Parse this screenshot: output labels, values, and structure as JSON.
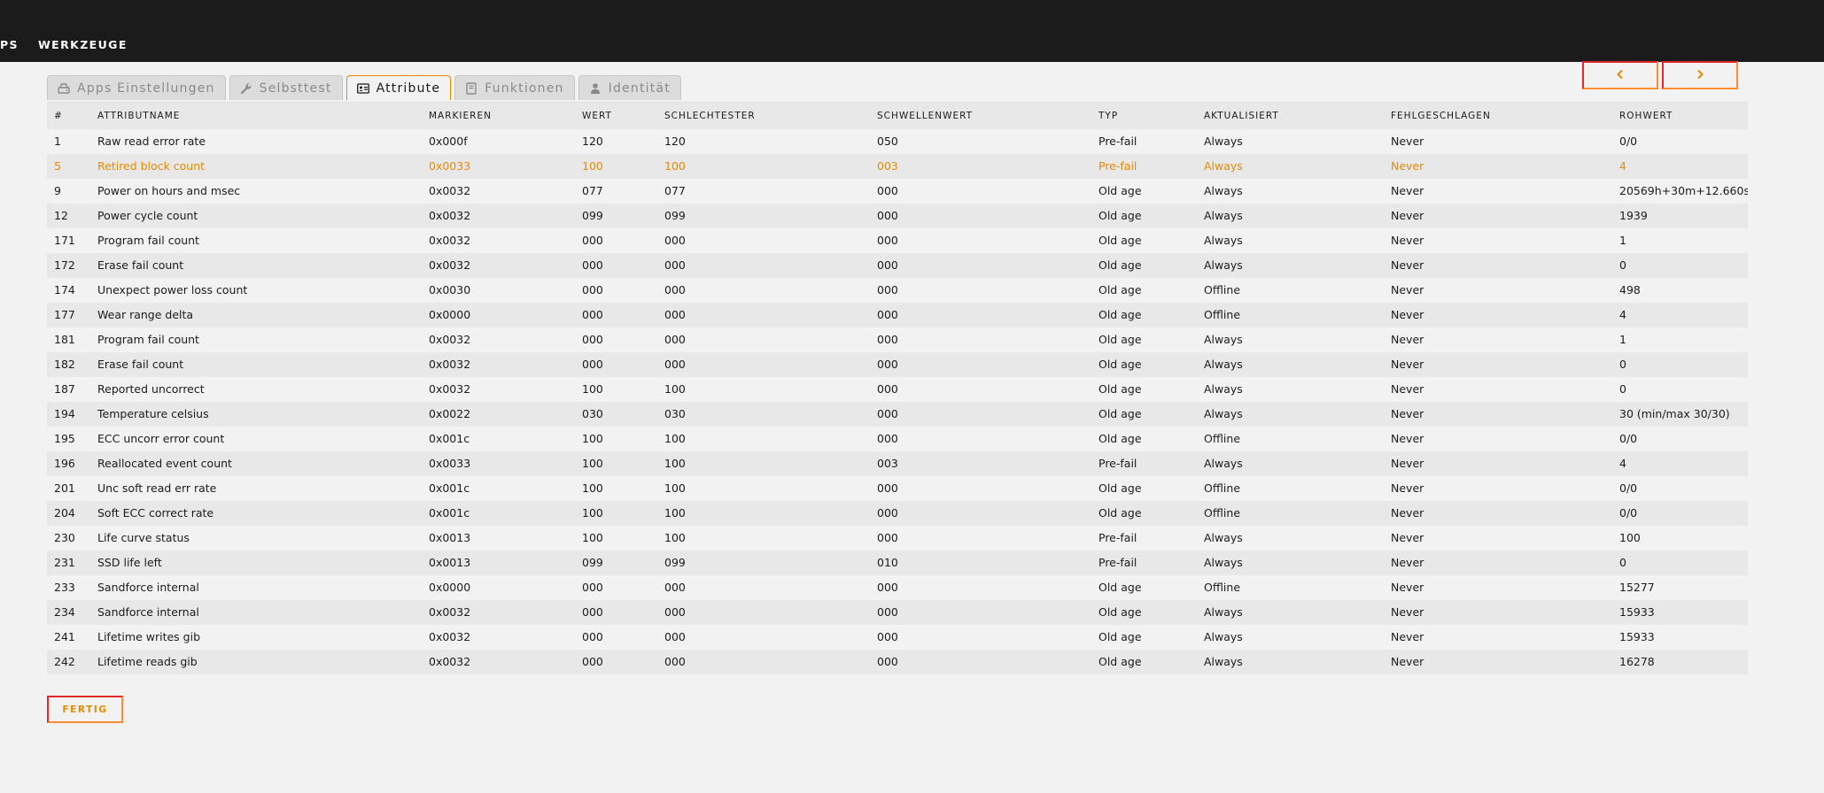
{
  "topnav": {
    "items": [
      "PS",
      "WERKZEUGE"
    ]
  },
  "tabs": [
    {
      "label": "Apps Einstellungen",
      "icon": "hdd-icon",
      "active": false
    },
    {
      "label": "Selbsttest",
      "icon": "wrench-icon",
      "active": false
    },
    {
      "label": "Attribute",
      "icon": "id-card-icon",
      "active": true
    },
    {
      "label": "Funktionen",
      "icon": "book-icon",
      "active": false
    },
    {
      "label": "Identität",
      "icon": "user-icon",
      "active": false
    }
  ],
  "navigation": {
    "prev_icon": "chevron-left-icon",
    "next_icon": "chevron-right-icon"
  },
  "colors": {
    "accent": "#e68a00",
    "border_red": "#e22828",
    "topbar": "#1c1b1b"
  },
  "table": {
    "headers": [
      "#",
      "ATTRIBUTNAME",
      "MARKIEREN",
      "WERT",
      "SCHLECHTESTER",
      "SCHWELLENWERT",
      "TYP",
      "AKTUALISIERT",
      "FEHLGESCHLAGEN",
      "ROHWERT"
    ],
    "rows": [
      [
        "1",
        "Raw read error rate",
        "0x000f",
        "120",
        "120",
        "050",
        "Pre-fail",
        "Always",
        "Never",
        "0/0"
      ],
      [
        "5",
        "Retired block count",
        "0x0033",
        "100",
        "100",
        "003",
        "Pre-fail",
        "Always",
        "Never",
        "4"
      ],
      [
        "9",
        "Power on hours and msec",
        "0x0032",
        "077",
        "077",
        "000",
        "Old age",
        "Always",
        "Never",
        "20569h+30m+12.660s"
      ],
      [
        "12",
        "Power cycle count",
        "0x0032",
        "099",
        "099",
        "000",
        "Old age",
        "Always",
        "Never",
        "1939"
      ],
      [
        "171",
        "Program fail count",
        "0x0032",
        "000",
        "000",
        "000",
        "Old age",
        "Always",
        "Never",
        "1"
      ],
      [
        "172",
        "Erase fail count",
        "0x0032",
        "000",
        "000",
        "000",
        "Old age",
        "Always",
        "Never",
        "0"
      ],
      [
        "174",
        "Unexpect power loss count",
        "0x0030",
        "000",
        "000",
        "000",
        "Old age",
        "Offline",
        "Never",
        "498"
      ],
      [
        "177",
        "Wear range delta",
        "0x0000",
        "000",
        "000",
        "000",
        "Old age",
        "Offline",
        "Never",
        "4"
      ],
      [
        "181",
        "Program fail count",
        "0x0032",
        "000",
        "000",
        "000",
        "Old age",
        "Always",
        "Never",
        "1"
      ],
      [
        "182",
        "Erase fail count",
        "0x0032",
        "000",
        "000",
        "000",
        "Old age",
        "Always",
        "Never",
        "0"
      ],
      [
        "187",
        "Reported uncorrect",
        "0x0032",
        "100",
        "100",
        "000",
        "Old age",
        "Always",
        "Never",
        "0"
      ],
      [
        "194",
        "Temperature celsius",
        "0x0022",
        "030",
        "030",
        "000",
        "Old age",
        "Always",
        "Never",
        "30 (min/max 30/30)"
      ],
      [
        "195",
        "ECC uncorr error count",
        "0x001c",
        "100",
        "100",
        "000",
        "Old age",
        "Offline",
        "Never",
        "0/0"
      ],
      [
        "196",
        "Reallocated event count",
        "0x0033",
        "100",
        "100",
        "003",
        "Pre-fail",
        "Always",
        "Never",
        "4"
      ],
      [
        "201",
        "Unc soft read err rate",
        "0x001c",
        "100",
        "100",
        "000",
        "Old age",
        "Offline",
        "Never",
        "0/0"
      ],
      [
        "204",
        "Soft ECC correct rate",
        "0x001c",
        "100",
        "100",
        "000",
        "Old age",
        "Offline",
        "Never",
        "0/0"
      ],
      [
        "230",
        "Life curve status",
        "0x0013",
        "100",
        "100",
        "000",
        "Pre-fail",
        "Always",
        "Never",
        "100"
      ],
      [
        "231",
        "SSD life left",
        "0x0013",
        "099",
        "099",
        "010",
        "Pre-fail",
        "Always",
        "Never",
        "0"
      ],
      [
        "233",
        "Sandforce internal",
        "0x0000",
        "000",
        "000",
        "000",
        "Old age",
        "Offline",
        "Never",
        "15277"
      ],
      [
        "234",
        "Sandforce internal",
        "0x0032",
        "000",
        "000",
        "000",
        "Old age",
        "Always",
        "Never",
        "15933"
      ],
      [
        "241",
        "Lifetime writes gib",
        "0x0032",
        "000",
        "000",
        "000",
        "Old age",
        "Always",
        "Never",
        "15933"
      ],
      [
        "242",
        "Lifetime reads gib",
        "0x0032",
        "000",
        "000",
        "000",
        "Old age",
        "Always",
        "Never",
        "16278"
      ]
    ],
    "highlighted_row": 1
  },
  "footer": {
    "done_label": "FERTIG"
  }
}
